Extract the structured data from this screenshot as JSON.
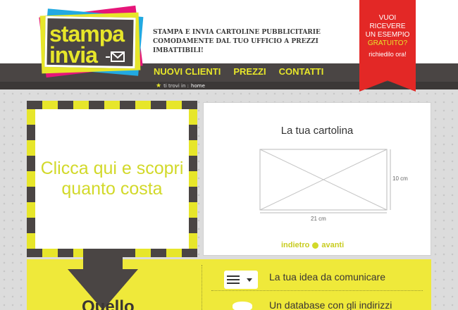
{
  "logo": {
    "line1": "stampa",
    "line2": "invia"
  },
  "tagline": "STAMPA E INVIA CARTOLINE PUBBLICITARIE COMODAMENTE DAL TUO UFFICIO A PREZZI IMBATTIBILI!",
  "nav": {
    "items": [
      "NUOVI CLIENTI",
      "PREZZI",
      "CONTATTI"
    ]
  },
  "breadcrumb": {
    "prefix": "ti trovi in :",
    "current": "home"
  },
  "ribbon": {
    "line1": "VUOI",
    "line2": "RICEVERE",
    "line3": "UN ESEMPIO",
    "line4": "GRATUITO?",
    "line5": "richiedilo ora!"
  },
  "promo": {
    "text": "Clicca qui e scopri quanto costa"
  },
  "card": {
    "title": "La tua cartolina",
    "width_label": "21 cm",
    "height_label": "10 cm"
  },
  "pager": {
    "prev": "indietro",
    "next": "avanti"
  },
  "features": {
    "item1": "La tua idea da comunicare",
    "item2": "Un database con gli indirizzi"
  },
  "bottom": {
    "heading": "Quello"
  },
  "colors": {
    "yellow": "#e7e62a",
    "dark": "#4a4544",
    "red": "#e32826",
    "magenta": "#e6157a",
    "cyan": "#22a9e1"
  }
}
